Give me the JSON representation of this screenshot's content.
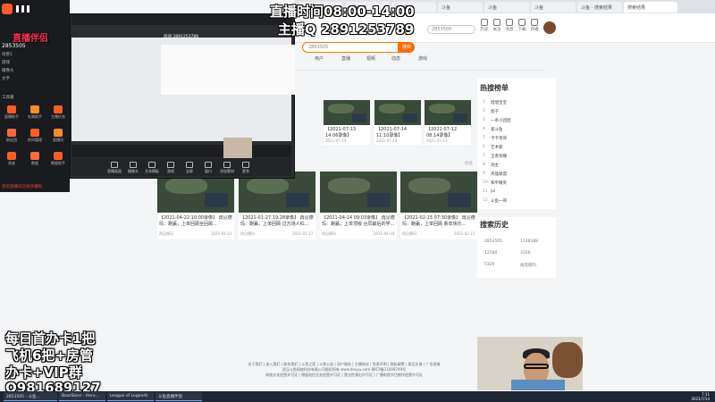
{
  "overlay": {
    "live_time": "直播时间08:00-14:00",
    "anchor_qq": "主播Q 2891253789",
    "promo": [
      "每日首办卡1把",
      "飞机6把+房管",
      "办卡+VIP群",
      "Q981689127"
    ],
    "logo_text": "直播伴侣"
  },
  "left_panel": {
    "room_id": "2853505",
    "section_label": "工具箱",
    "tools": [
      "直播助手",
      "礼物助手",
      "主播任务",
      "粉丝团",
      "房间管理",
      "直播间",
      "贵族",
      "数据",
      "数据助手"
    ],
    "scene_items": [
      "场景1",
      "游戏",
      "摄像头",
      "文字"
    ],
    "bottom_notice": "您的直播间已经开播啦"
  },
  "obs": {
    "url_text": "房间 2891253789",
    "toolbar": [
      "直播画面",
      "摄像头",
      "文本模板",
      "游戏",
      "全屏",
      "窗口",
      "添加素材",
      "更多"
    ]
  },
  "browser": {
    "tabs": [
      "斗鱼",
      "斗鱼搜索",
      "斗鱼直播",
      "斗鱼",
      "斗鱼",
      "斗鱼",
      "斗鱼 - 搜索结果",
      "搜索结果"
    ],
    "search_value": "2853505",
    "search_btn": "搜索",
    "header_icons": [
      "历史",
      "关注",
      "消息",
      "下载",
      "开播"
    ],
    "nav_tabs": [
      "用户",
      "直播",
      "视频",
      "动态",
      "游戏"
    ]
  },
  "results_top": [
    {
      "title": "【2021-07-13 14:06录像】",
      "meta": "2021-07-14"
    },
    {
      "title": "【2021-07-14 11:10录像】",
      "meta": "2021-07-14"
    },
    {
      "title": "【2021-07-12 08:14录像】",
      "meta": "2021-07-13"
    }
  ],
  "results_bottom": [
    {
      "title": "【2021-04-22 10:00录像】 再见德玛：跑赢，上单回顾全回顾...",
      "author": "再见德玛",
      "meta": "2021-04-22"
    },
    {
      "title": "【2021-01-27 19:28录像】 再见德玛：跑赢，上单回顾 过万场人红...",
      "author": "再见德玛",
      "meta": "2021-01-27"
    },
    {
      "title": "【2021-04-14 09:03录像】 再见德玛：跑赢，上单顶级 合同最后的学...",
      "author": "再见德玛",
      "meta": "2021-04-14"
    },
    {
      "title": "【2021-02-15 07:30录像】 再见德玛：跑赢，上单回顾 新年快乐...",
      "author": "再见德玛",
      "meta": "2021-02-15"
    }
  ],
  "sort_label": "综合",
  "rank": {
    "title": "热搜榜单",
    "items": [
      "旭旭宝宝",
      "痞子",
      "一条小团团",
      "爱斗鱼",
      "卡卡哥哥",
      "艺术家",
      "王者荣耀",
      "洞主",
      "英雄联盟",
      "和平精英",
      "jul",
      "斗鱼一哥"
    ]
  },
  "history": {
    "title": "搜索历史",
    "items": [
      "2853505",
      "1148388",
      "12580",
      "3356",
      "5320",
      "再见德玛"
    ]
  },
  "footer": {
    "line1": "关于我们 | 加入我们 | 联系我们 | 斗鱼之家 | 斗鱼公益 | 用户服务 | 主播协议 | 免责声明 | 隐私政策 | 意见反馈 | 广告投放",
    "line2": "武汉斗鱼网络科技有限公司版权所有 www.douyu.com 鄂ICP备11008749号",
    "line3": "网络文化经营许可证 | 增值电信业务经营许可证 | 营业性演出许可证 | 广播电视节目制作经营许可证"
  },
  "taskbar": {
    "items": [
      "2853505 - 斗鱼...",
      "BossSkins - Hero...",
      "League of Legends",
      "斗鱼直播伴侣"
    ],
    "time": "7:11",
    "date": "2021/7/14"
  }
}
